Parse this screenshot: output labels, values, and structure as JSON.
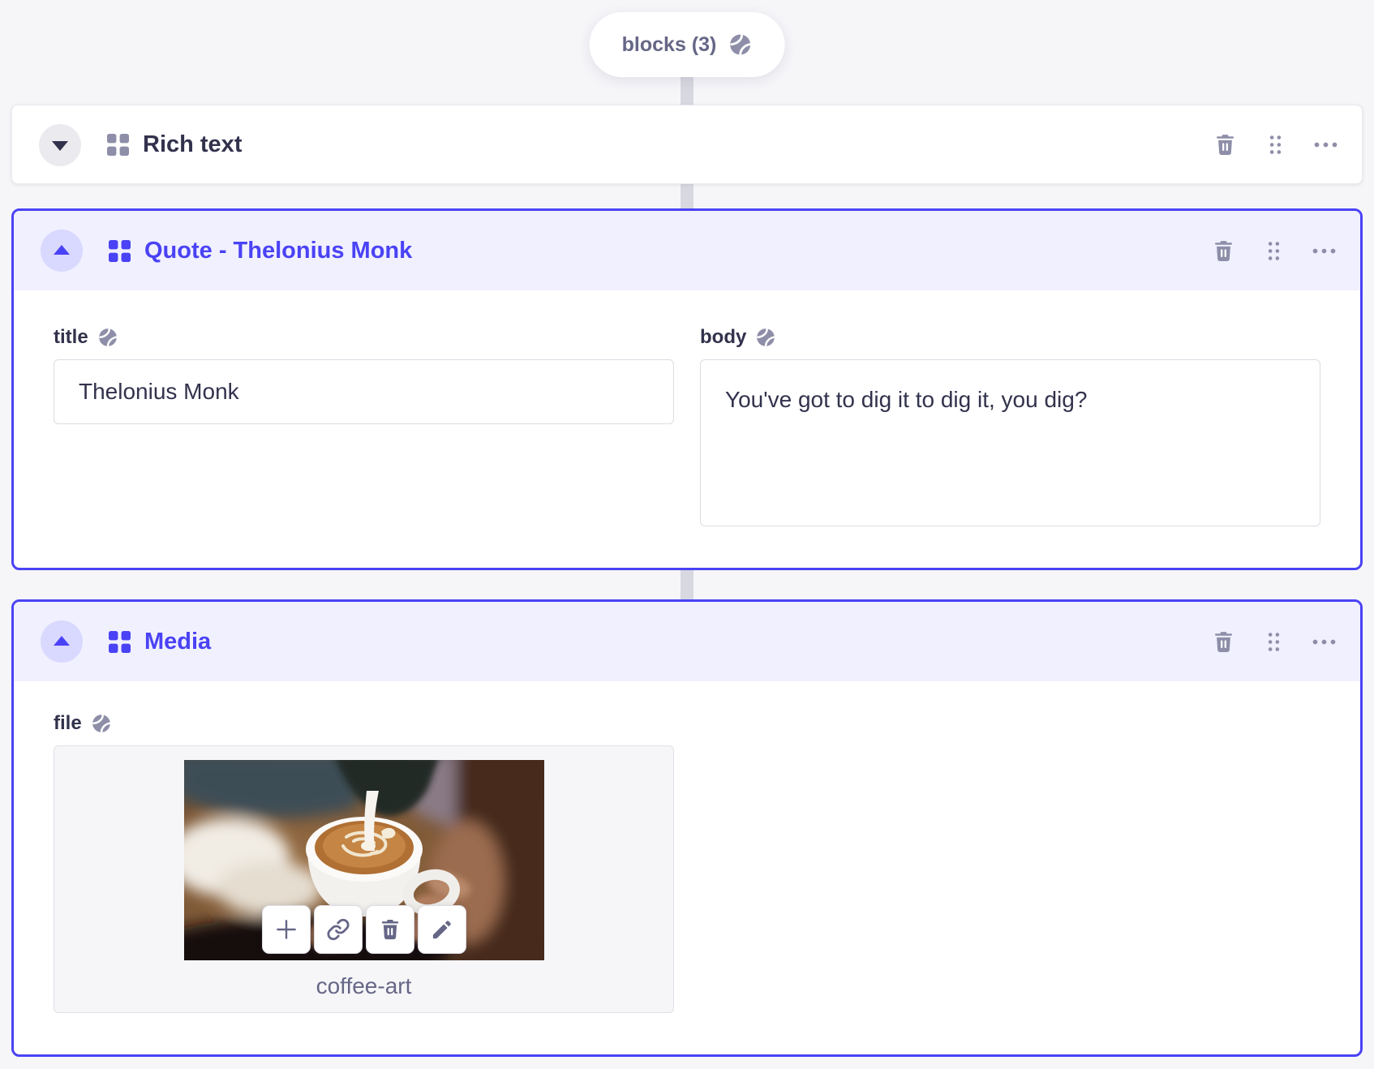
{
  "pill": {
    "label": "blocks (3)",
    "icon": "globe-icon"
  },
  "blocks": {
    "rich_text": {
      "title": "Rich text",
      "state": "collapsed"
    },
    "quote": {
      "title": "Quote - Thelonius Monk",
      "state": "expanded",
      "fields": {
        "title": {
          "label": "title",
          "value": "Thelonius Monk"
        },
        "body": {
          "label": "body",
          "value": "You've got to dig it to dig it, you dig?"
        }
      }
    },
    "media": {
      "title": "Media",
      "state": "expanded",
      "fields": {
        "file": {
          "label": "file",
          "file_name": "coffee-art"
        }
      }
    }
  },
  "colors": {
    "accent": "#4a42f5",
    "accent_header_bg": "#f0f0ff",
    "accent_toggle_bg": "#d9d8ff",
    "page_bg": "#f6f6f9",
    "icon_gray": "#8e8ea9",
    "text_dark": "#32324d",
    "text_gray": "#666687",
    "input_border": "#dcdce4",
    "connector": "#d8d8e0"
  }
}
